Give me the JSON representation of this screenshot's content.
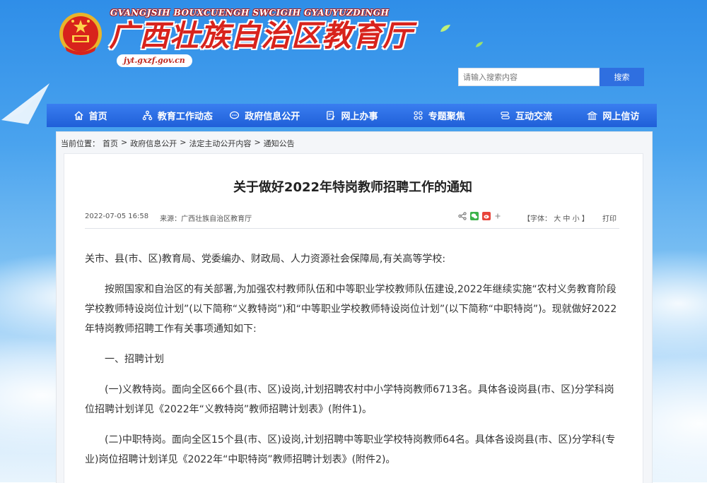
{
  "header": {
    "site_name_en": "GVANGJSIH BOUXCUENGH SWCIGIH GYAUYUZDINGH",
    "site_name_cn": "广西壮族自治区教育厅",
    "site_url": "jyt.gxzf.gov.cn",
    "search_placeholder": "请输入搜索内容",
    "search_button": "搜索"
  },
  "nav": {
    "items": [
      {
        "label": "首页",
        "icon": "home-icon"
      },
      {
        "label": "教育工作动态",
        "icon": "org-chart-icon"
      },
      {
        "label": "政府信息公开",
        "icon": "chat-bubble-icon"
      },
      {
        "label": "网上办事",
        "icon": "edit-document-icon"
      },
      {
        "label": "专题聚焦",
        "icon": "grid-icon"
      },
      {
        "label": "互动交流",
        "icon": "exchange-icon"
      },
      {
        "label": "网上信访",
        "icon": "building-icon"
      }
    ]
  },
  "breadcrumb": {
    "prefix": "当前位置：",
    "items": [
      "首页",
      "政府信息公开",
      "法定主动公开内容",
      "通知公告"
    ],
    "separator": ">"
  },
  "article": {
    "title": "关于做好2022年特岗教师招聘工作的通知",
    "date": "2022-07-05 16:58",
    "source": "来源：广西壮族自治区教育厅",
    "font_size_label": "【字体：",
    "font_size_options": [
      "大",
      "中",
      "小"
    ],
    "font_size_close": "】",
    "print_label": "打印",
    "paragraphs": [
      "关市、县(市、区)教育局、党委编办、财政局、人力资源社会保障局,有关高等学校:",
      "按照国家和自治区的有关部署,为加强农村教师队伍和中等职业学校教师队伍建设,2022年继续实施“农村义务教育阶段学校教师特设岗位计划”(以下简称“义教特岗”)和“中等职业学校教师特设岗位计划”(以下简称“中职特岗”)。现就做好2022年特岗教师招聘工作有关事项通知如下:",
      "一、招聘计划",
      "(一)义教特岗。面向全区66个县(市、区)设岗,计划招聘农村中小学特岗教师6713名。具体各设岗县(市、区)分学科岗位招聘计划详见《2022年“义教特岗”教师招聘计划表》(附件1)。",
      "(二)中职特岗。面向全区15个县(市、区)设岗,计划招聘中等职业学校特岗教师64名。具体各设岗县(市、区)分学科(专业)岗位招聘计划详见《2022年“中职特岗”教师招聘计划表》(附件2)。"
    ]
  },
  "colors": {
    "nav_blue": "#2a6fe6",
    "title_red": "#d8231c",
    "search_blue": "#2f6fe0"
  }
}
